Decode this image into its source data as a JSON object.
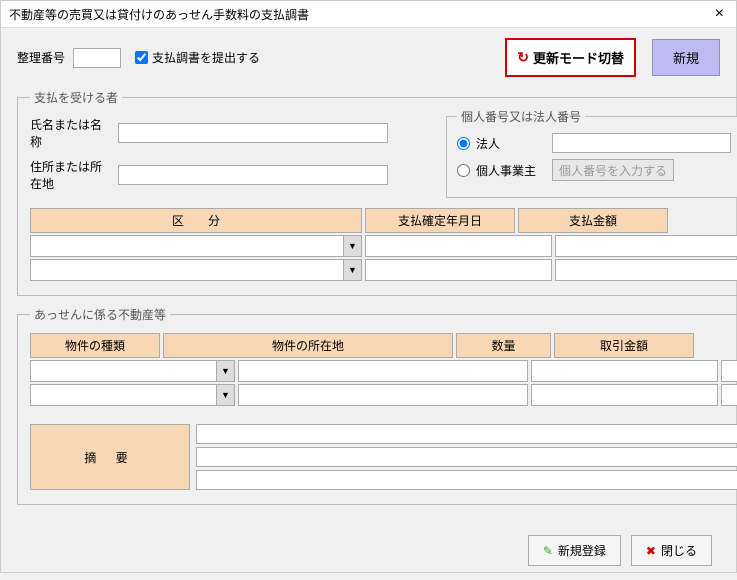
{
  "window": {
    "title": "不動産等の売買又は貸付けのあっせん手数料の支払調書"
  },
  "top": {
    "ref_label": "整理番号",
    "ref_value": "",
    "submit_checkbox_label": "支払調書を提出する",
    "submit_checked": true,
    "update_mode_label": "更新モード切替",
    "new_label": "新規"
  },
  "payee": {
    "legend": "支払を受ける者",
    "name_label": "氏名または名称",
    "name_value": "",
    "addr_label": "住所または所在地",
    "addr_value": "",
    "number_box": {
      "legend": "個人番号又は法人番号",
      "corp_label": "法人",
      "indiv_label": "個人事業主",
      "selected": "corp",
      "corp_value": "",
      "input_btn": "個人番号を入力する"
    },
    "grid": {
      "headers": {
        "kubun": "区　　分",
        "date": "支払確定年月日",
        "amount": "支払金額"
      },
      "rows": [
        {
          "kubun": "",
          "date": "",
          "amount": ""
        },
        {
          "kubun": "",
          "date": "",
          "amount": ""
        }
      ]
    }
  },
  "property": {
    "legend": "あっせんに係る不動産等",
    "headers": {
      "type": "物件の種類",
      "location": "物件の所在地",
      "qty": "数量",
      "deal": "取引金額"
    },
    "rows": [
      {
        "type": "",
        "location": "",
        "qty": "",
        "deal": ""
      },
      {
        "type": "",
        "location": "",
        "qty": "",
        "deal": ""
      }
    ]
  },
  "summary": {
    "label": "摘 要",
    "line1": "",
    "line2": "",
    "line3": ""
  },
  "buttons": {
    "register": "新規登録",
    "close": "閉じる"
  }
}
